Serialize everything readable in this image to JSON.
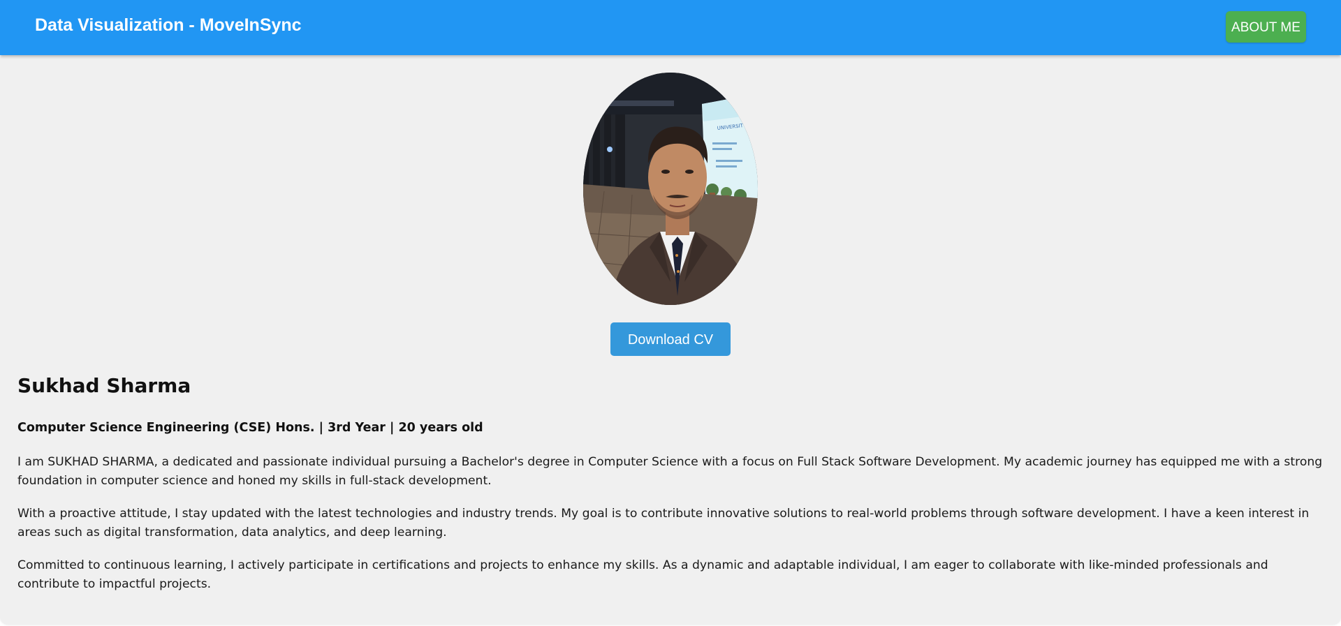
{
  "header": {
    "title": "Data Visualization - MoveInSync",
    "about_button": "ABOUT ME"
  },
  "profile": {
    "photo_icon": "profile-photo",
    "download_button": "Download CV",
    "name": "Sukhad Sharma",
    "subtitle": "Computer Science Engineering (CSE) Hons. | 3rd Year | 20 years old",
    "bio": [
      "I am SUKHAD SHARMA, a dedicated and passionate individual pursuing a Bachelor's degree in Computer Science with a focus on Full Stack Software Development. My academic journey has equipped me with a strong foundation in computer science and honed my skills in full-stack development.",
      "With a proactive attitude, I stay updated with the latest technologies and industry trends. My goal is to contribute innovative solutions to real-world problems through software development. I have a keen interest in areas such as digital transformation, data analytics, and deep learning.",
      "Committed to continuous learning, I actively participate in certifications and projects to enhance my skills. As a dynamic and adaptable individual, I am eager to collaborate with like-minded professionals and contribute to impactful projects."
    ]
  },
  "colors": {
    "header_bg": "#2196f3",
    "about_button_bg": "#4caf50",
    "download_button_bg": "#3498db",
    "card_bg": "#f0f0f0"
  }
}
